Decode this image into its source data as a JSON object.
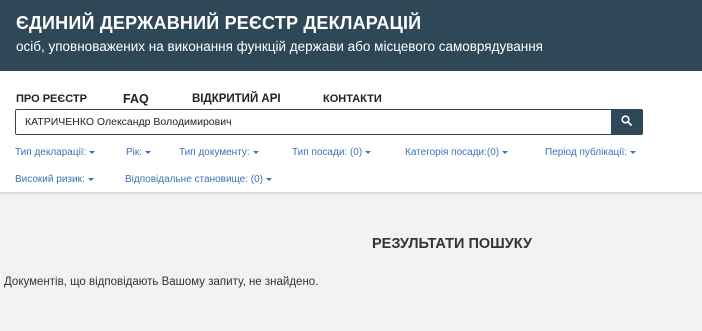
{
  "header": {
    "title": "ЄДИНИЙ ДЕРЖАВНИЙ РЕЄСТР ДЕКЛАРАЦІЙ",
    "subtitle": "осіб, уповноважених на виконання функцій держави або місцевого самоврядування"
  },
  "nav": {
    "about": "ПРО РЕЄСТР",
    "faq": "FAQ",
    "open_api": "ВІДКРИТИЙ API",
    "contacts": "КОНТАКТИ"
  },
  "search": {
    "value": "КАТРИЧЕНКО Олександр Володимирович",
    "placeholder": ""
  },
  "filters": {
    "declaration_type": "Тип декларації:",
    "year": "Рік:",
    "document_type": "Тип документу:",
    "position_type": "Тип посади: (0)",
    "position_category": "Категорія посади:(0)",
    "publication_period": "Період публікації:",
    "high_risk": "Високий ризик:",
    "responsible_position": "Відповідальне становище: (0)"
  },
  "results": {
    "title": "РЕЗУЛЬТАТИ ПОШУКУ",
    "empty_message": "Документів, що відповідають Вашому запиту, не знайдено."
  },
  "colors": {
    "header_bg": "#2f4858",
    "link": "#3a73b8",
    "page_bg": "#f2f2f2"
  },
  "icons": {
    "search": "search-icon",
    "caret": "caret-down-icon"
  }
}
